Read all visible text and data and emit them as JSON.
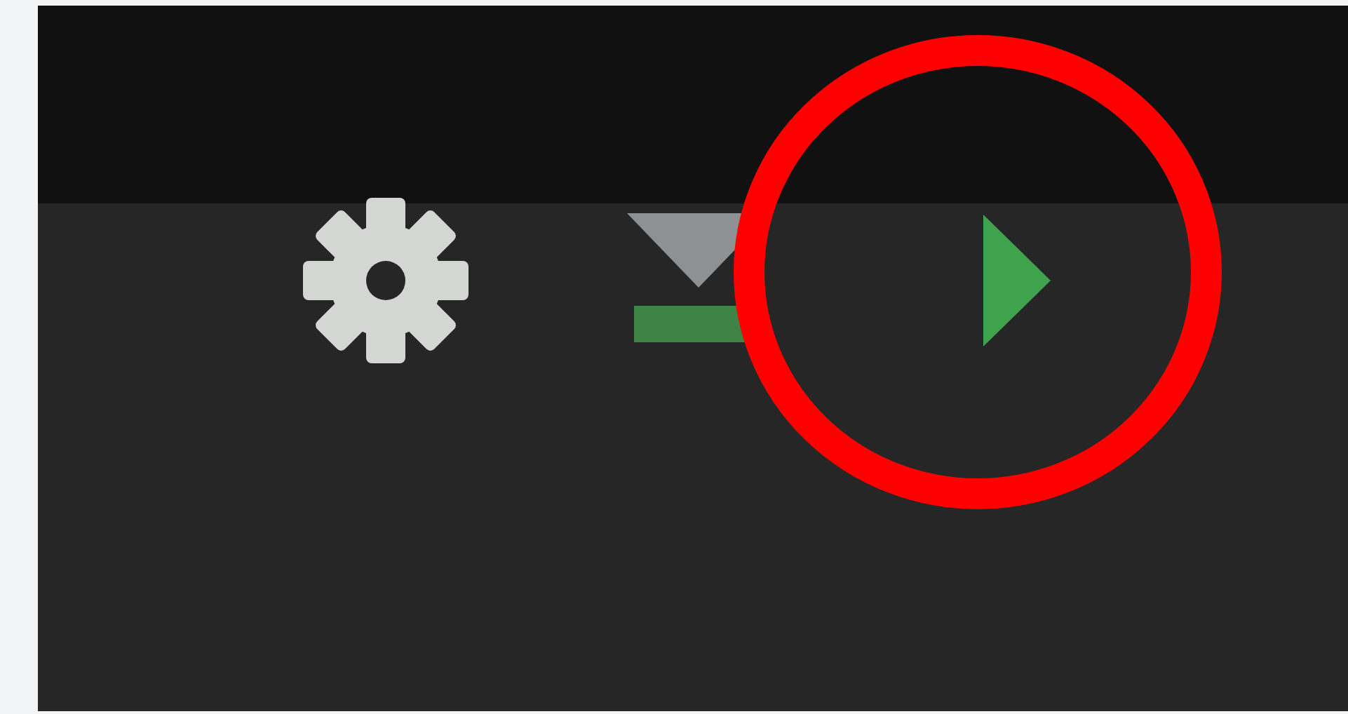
{
  "toolbar": {
    "buttons": [
      {
        "kind": "settings",
        "highlighted": false
      },
      {
        "kind": "deploy",
        "highlighted": false
      },
      {
        "kind": "run",
        "highlighted": true
      }
    ]
  }
}
